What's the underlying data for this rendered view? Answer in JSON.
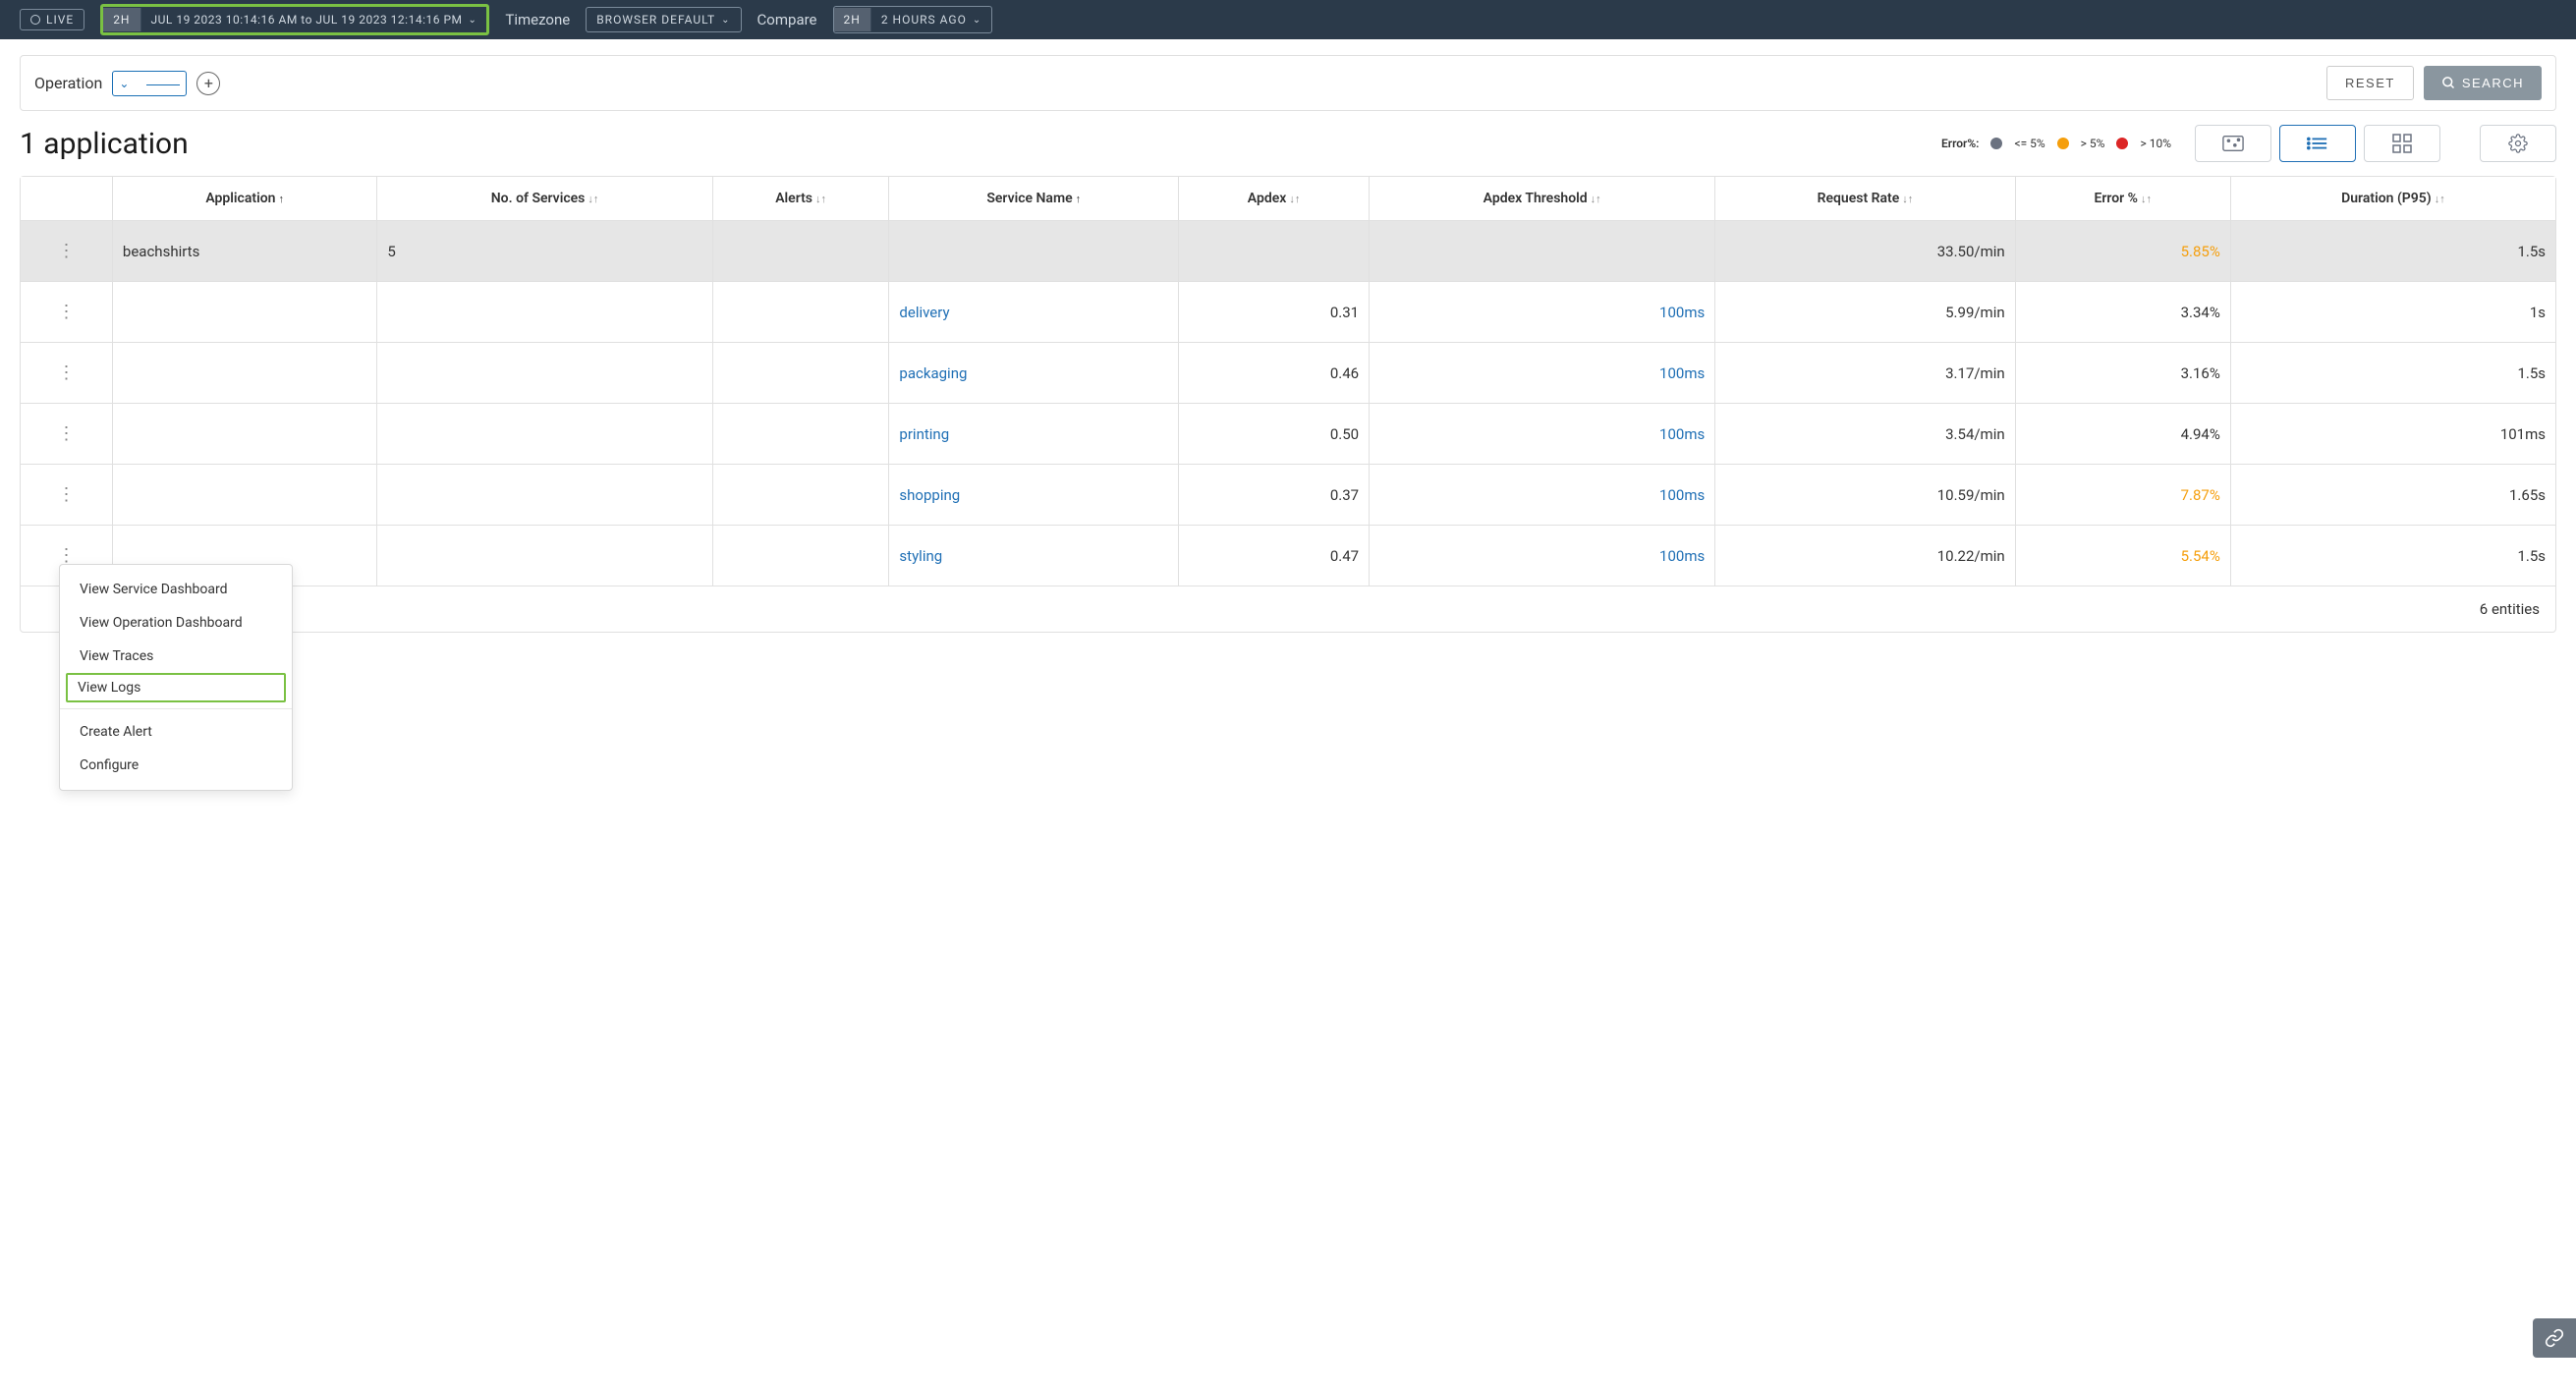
{
  "topbar": {
    "live": "LIVE",
    "time_badge": "2H",
    "time_range": "JUL 19 2023 10:14:16 AM to JUL 19 2023 12:14:16 PM",
    "tz_label": "Timezone",
    "tz_value": "BROWSER DEFAULT",
    "compare_label": "Compare",
    "compare_badge": "2H",
    "compare_value": "2 HOURS AGO"
  },
  "filter": {
    "operation_label": "Operation",
    "reset": "RESET",
    "search": "SEARCH"
  },
  "title": "1 application",
  "legend": {
    "label": "Error%:",
    "l1": "<= 5%",
    "l2": "> 5%",
    "l3": "> 10%"
  },
  "table": {
    "headers": {
      "application": "Application",
      "services_count": "No. of Services",
      "alerts": "Alerts",
      "service_name": "Service Name",
      "apdex": "Apdex",
      "apdex_threshold": "Apdex Threshold",
      "request_rate": "Request Rate",
      "error_pct": "Error %",
      "duration": "Duration (P95)"
    },
    "app_row": {
      "application": "beachshirts",
      "services_count": "5",
      "request_rate": "33.50/min",
      "error_pct": "5.85%",
      "error_warn": true,
      "duration": "1.5s"
    },
    "rows": [
      {
        "service": "delivery",
        "apdex": "0.31",
        "threshold": "100ms",
        "rate": "5.99/min",
        "err": "3.34%",
        "err_warn": false,
        "dur": "1s"
      },
      {
        "service": "packaging",
        "apdex": "0.46",
        "threshold": "100ms",
        "rate": "3.17/min",
        "err": "3.16%",
        "err_warn": false,
        "dur": "1.5s"
      },
      {
        "service": "printing",
        "apdex": "0.50",
        "threshold": "100ms",
        "rate": "3.54/min",
        "err": "4.94%",
        "err_warn": false,
        "dur": "101ms"
      },
      {
        "service": "shopping",
        "apdex": "0.37",
        "threshold": "100ms",
        "rate": "10.59/min",
        "err": "7.87%",
        "err_warn": true,
        "dur": "1.65s"
      },
      {
        "service": "styling",
        "apdex": "0.47",
        "threshold": "100ms",
        "rate": "10.22/min",
        "err": "5.54%",
        "err_warn": true,
        "dur": "1.5s"
      }
    ],
    "footer": "6 entities"
  },
  "context_menu": {
    "items": [
      "View Service Dashboard",
      "View Operation Dashboard",
      "View Traces",
      "View Logs"
    ],
    "items2": [
      "Create Alert",
      "Configure"
    ],
    "highlighted": "View Logs"
  }
}
